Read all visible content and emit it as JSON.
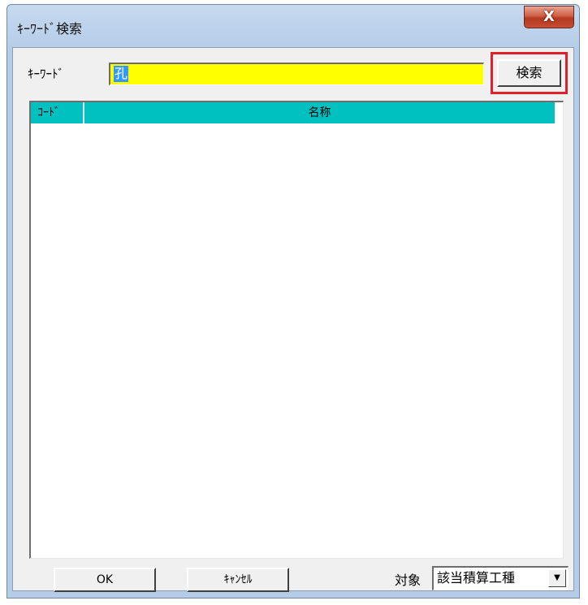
{
  "window": {
    "title": "ｷｰﾜｰﾄﾞ検索",
    "close_label": "X"
  },
  "keyword": {
    "label": "ｷｰﾜｰﾄﾞ",
    "value": "孔",
    "field_color": "#ffff00"
  },
  "search_button": {
    "label": "検索",
    "highlight_color": "#e0202a"
  },
  "results_table": {
    "header_color": "#00c0c0",
    "columns": [
      {
        "label": "ｺｰﾄﾞ"
      },
      {
        "label": "名称"
      }
    ],
    "rows": []
  },
  "footer": {
    "ok_label": "OK",
    "cancel_label": "ｷｬﾝｾﾙ",
    "target_label": "対象",
    "target_selected": "該当積算工種",
    "dropdown_icon": "chevron-down-icon"
  }
}
